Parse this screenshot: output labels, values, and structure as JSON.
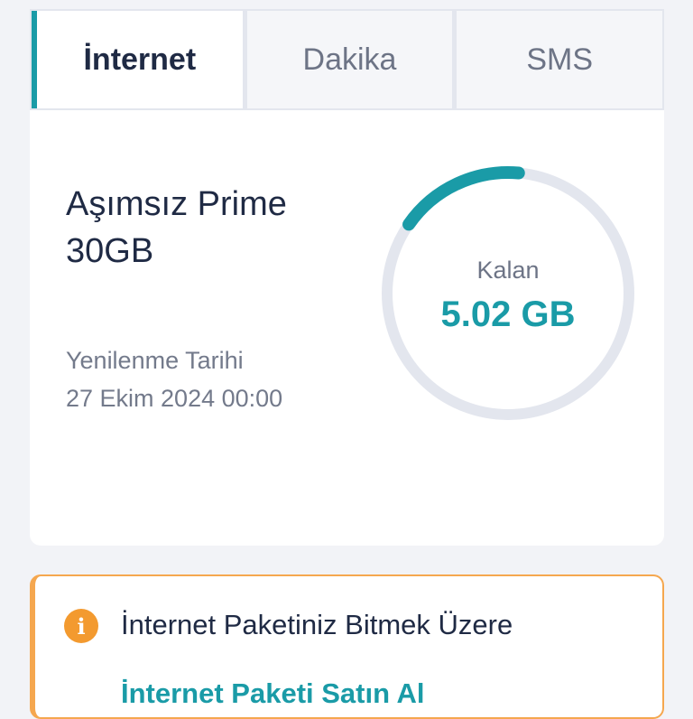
{
  "tabs": {
    "internet": "İnternet",
    "minutes": "Dakika",
    "sms": "SMS",
    "active": "internet"
  },
  "plan": {
    "name": "Aşımsız Prime 30GB",
    "renewal_label": "Yenilenme Tarihi",
    "renewal_date": "27 Ekim 2024 00:00"
  },
  "usage": {
    "remaining_label": "Kalan",
    "remaining_value": "5.02 GB",
    "remaining_fraction": 0.167,
    "colors": {
      "arc": "#1a9ba7",
      "track": "#e3e6ee"
    }
  },
  "alert": {
    "icon": "info-icon",
    "title": "İnternet Paketiniz Bitmek Üzere",
    "link": "İnternet Paketi Satın Al"
  },
  "colors": {
    "accent": "#1a9ba7",
    "warning": "#f5a74f",
    "text_primary": "#1f2a44",
    "text_secondary": "#737a8b"
  }
}
